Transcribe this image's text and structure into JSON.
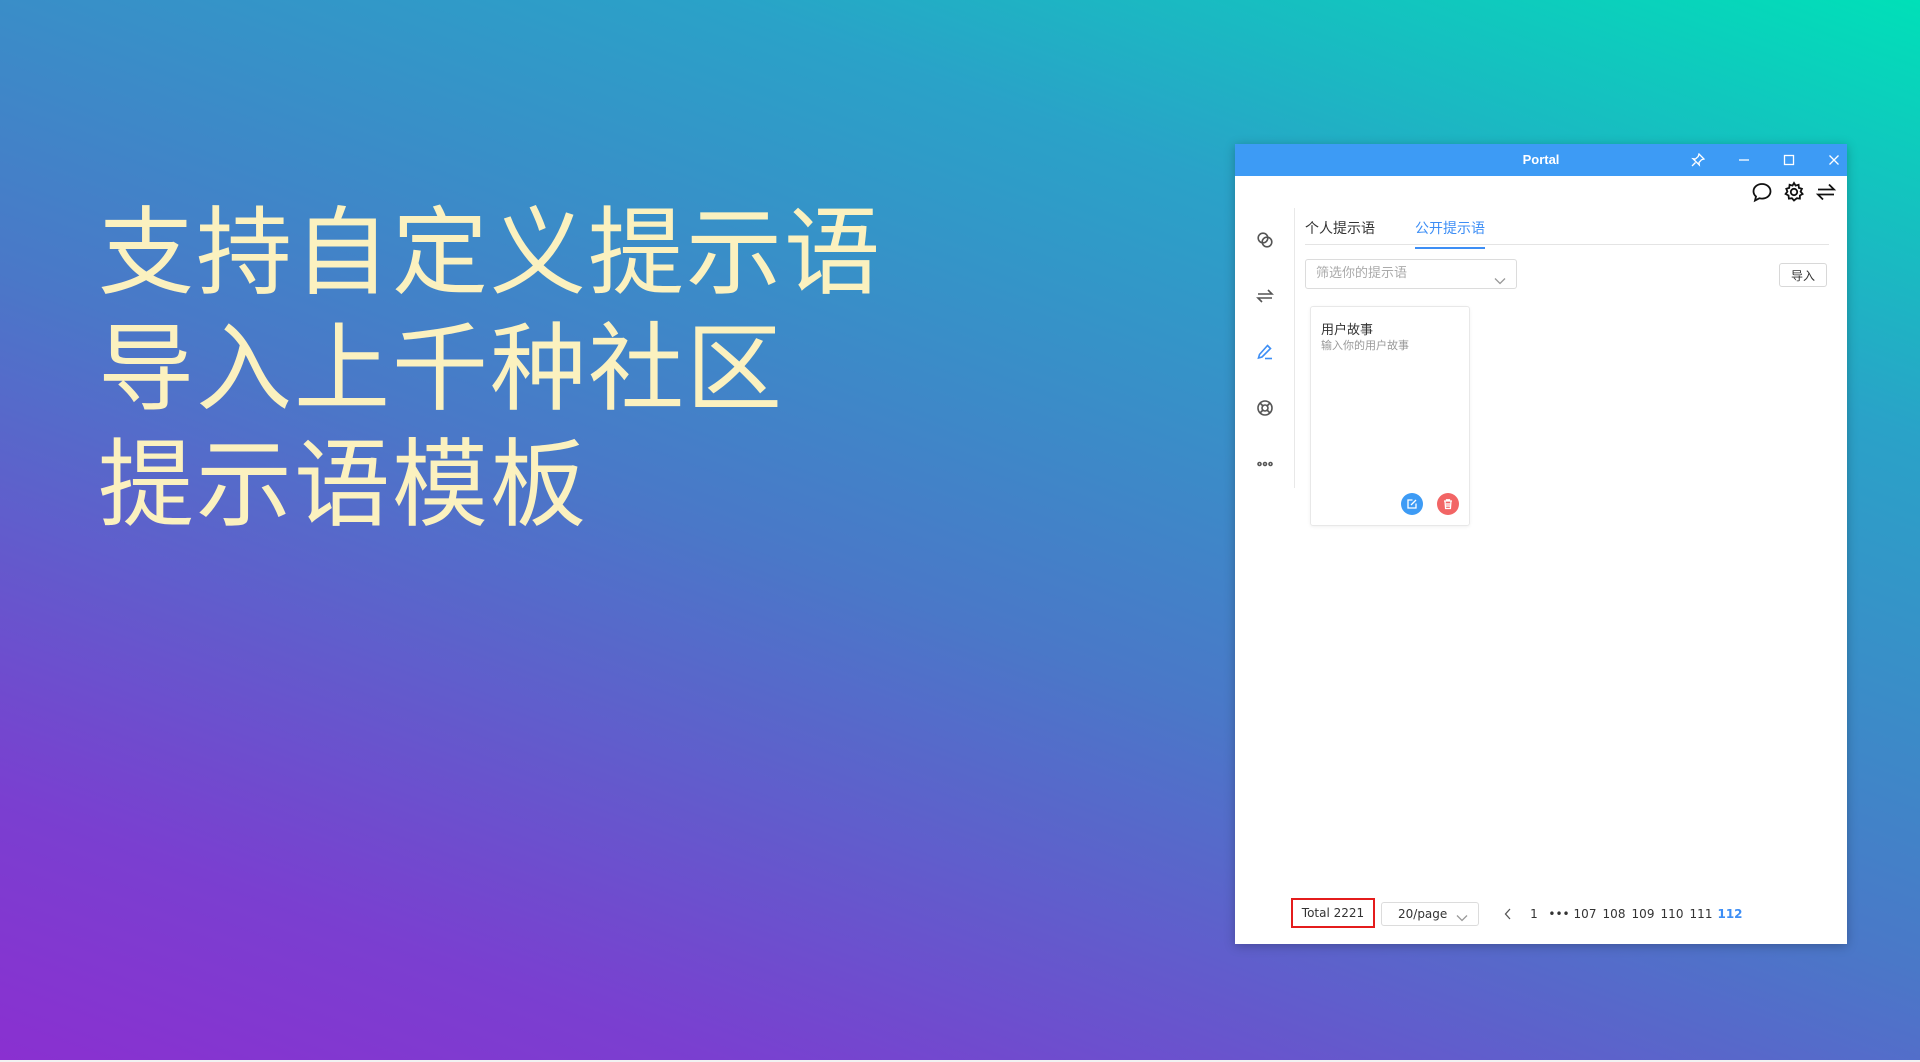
{
  "headline": {
    "line1": "支持自定义提示语",
    "line2": "导入上千种社区",
    "line3": "提示语模板"
  },
  "window": {
    "title": "Portal",
    "controls": [
      "pin-icon",
      "minimize-icon",
      "maximize-icon",
      "close-icon"
    ],
    "top_icons": [
      "chat-bubble-icon",
      "gear-icon",
      "swap-icon"
    ]
  },
  "sidebar": {
    "items": [
      {
        "icon": "link-chat-icon",
        "active": false
      },
      {
        "icon": "swap-icon",
        "active": false
      },
      {
        "icon": "pen-icon",
        "active": true
      },
      {
        "icon": "lifebuoy-icon",
        "active": false
      },
      {
        "icon": "more-icon",
        "active": false
      }
    ]
  },
  "tabs": [
    {
      "label": "个人提示语",
      "active": false
    },
    {
      "label": "公开提示语",
      "active": true
    }
  ],
  "filter": {
    "placeholder": "筛选你的提示语",
    "value": ""
  },
  "import_label": "导入",
  "cards": [
    {
      "title": "用户故事",
      "description": "输入你的用户故事",
      "actions": [
        "edit-icon",
        "delete-icon"
      ]
    }
  ],
  "pagination": {
    "total": "Total 2221",
    "page_size": "20/page",
    "first": "1",
    "ellipsis": "•••",
    "pages": [
      "107",
      "108",
      "109",
      "110",
      "111",
      "112"
    ],
    "current": "112"
  },
  "colors": {
    "accent": "#3d8ef5",
    "titlebar": "#3d9bf5",
    "headline": "#fbf1bf",
    "delete": "#f26565",
    "highlight_box": "#e41c1c"
  }
}
